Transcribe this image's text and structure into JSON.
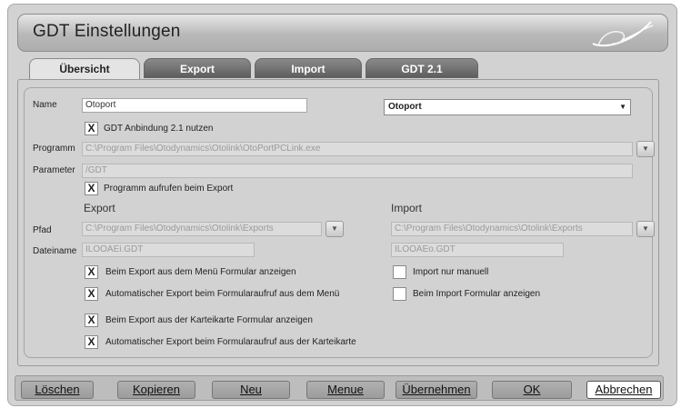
{
  "window": {
    "title": "GDT Einstellungen"
  },
  "tabs": [
    {
      "label": "Übersicht",
      "active": true
    },
    {
      "label": "Export",
      "active": false
    },
    {
      "label": "Import",
      "active": false
    },
    {
      "label": "GDT 2.1",
      "active": false
    }
  ],
  "form": {
    "name_label": "Name",
    "name_value": "Otoport",
    "device_select": "Otoport",
    "gdt21": {
      "checked": "X",
      "label": "GDT Anbindung 2.1 nutzen"
    },
    "programm_label": "Programm",
    "programm_value": "C:\\Program Files\\Otodynamics\\Otolink\\OtoPortPCLink.exe",
    "parameter_label": "Parameter",
    "parameter_value": "/GDT",
    "programm_export": {
      "checked": "X",
      "label": "Programm aufrufen beim Export"
    },
    "export_heading": "Export",
    "import_heading": "Import",
    "pfad_label": "Pfad",
    "export_path": "C:\\Program Files\\Otodynamics\\Otolink\\Exports",
    "import_path": "C:\\Program Files\\Otodynamics\\Otolink\\Exports",
    "dateiname_label": "Dateiname",
    "export_file": "ILOOAEi.GDT",
    "import_file": "ILOOAEo.GDT",
    "export_options": [
      {
        "checked": "X",
        "label": "Beim Export aus dem Menü Formular anzeigen"
      },
      {
        "checked": "X",
        "label": "Automatischer Export  beim Formularaufruf aus dem Menü"
      },
      {
        "checked": "X",
        "label": "Beim Export aus der Karteikarte Formular anzeigen"
      },
      {
        "checked": "X",
        "label": "Automatischer Export beim Formularaufruf aus der Karteikarte"
      }
    ],
    "import_options": [
      {
        "checked": "",
        "label": "Import nur manuell"
      },
      {
        "checked": "",
        "label": "Beim Import Formular anzeigen"
      }
    ]
  },
  "buttons": {
    "loeschen": "Löschen",
    "kopieren": "Kopieren",
    "neu": "Neu",
    "menue": "Menue",
    "uebernehmen": "Übernehmen",
    "ok": "OK",
    "abbrechen": "Abbrechen"
  },
  "icons": {
    "dropdown": "chevron-down-icon",
    "logo": "swoosh-logo"
  }
}
